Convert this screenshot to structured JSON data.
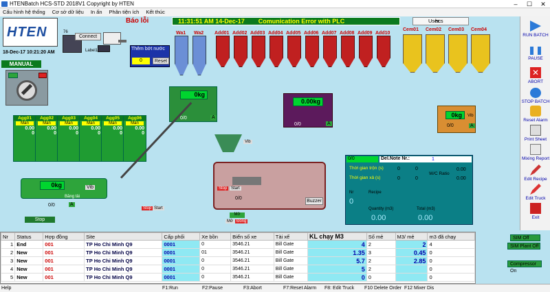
{
  "window": {
    "title": "HTENBatch HCS-STD 2018V1  Copyright by HTEN"
  },
  "menu": [
    "Cấu hình hệ thống",
    "Cơ sở dữ liệu",
    "In ấn",
    "Phân tiện ích",
    "Kết thúc"
  ],
  "header": {
    "alarm_title": "Báo lỗi",
    "time": "11:31:51 AM 14-Dec-17",
    "error": "Comunication Error with PLC",
    "user_label": "User:",
    "user": "hcs"
  },
  "logo": {
    "text": "HTEN",
    "datetime": "18-Dec-17  10:21:20 AM"
  },
  "mode": {
    "label": "MANUAL"
  },
  "network": {
    "connect": "Connect",
    "num": "76",
    "label": "Label1"
  },
  "water_add": {
    "title": "Thêm bớt nước",
    "value": "0",
    "reset": "Reset"
  },
  "water": [
    "Wa1",
    "Wa2"
  ],
  "additives": [
    "Add01",
    "Add02",
    "Add03",
    "Add04",
    "Add05",
    "Add06",
    "Add07",
    "Add08",
    "Add09",
    "Add10"
  ],
  "cements": [
    "Cem01",
    "Cem02",
    "Cem03",
    "Cem04"
  ],
  "aggregates": [
    {
      "name": "Agg01",
      "mode": "Man",
      "v1": "0.00",
      "v2": "0"
    },
    {
      "name": "Agg02",
      "mode": "Man",
      "v1": "0.00",
      "v2": "0"
    },
    {
      "name": "Agg03",
      "mode": "Man",
      "v1": "0.00",
      "v2": "0"
    },
    {
      "name": "Agg04",
      "mode": "Man",
      "v1": "0.00",
      "v2": "0"
    },
    {
      "name": "Agg05",
      "mode": "Man",
      "v1": "0.00",
      "v2": "0"
    },
    {
      "name": "Agg06",
      "mode": "Man",
      "v1": "0.00",
      "v2": "0"
    }
  ],
  "scales": {
    "water": {
      "value": "0kg",
      "ratio": "0/0",
      "flag": "A"
    },
    "additive": {
      "value": "0.00kg",
      "ratio": "0/0",
      "flag": "A"
    },
    "cement": {
      "value": "0kg",
      "ratio": "0/0",
      "flag": "A",
      "vib": "Vib"
    },
    "agg": {
      "value": "0kg",
      "ratio": "0/0",
      "flag": "A",
      "vib": "Vib",
      "belt": "Băng tải"
    }
  },
  "mixer": {
    "vib": "Vib",
    "ratio": "0/0",
    "buzzer": "Buzzer",
    "stop": "Stop",
    "start": "Start",
    "label": "Mở",
    "open": "Mở",
    "close": "Đóng"
  },
  "conveyor": {
    "stop": "Stop",
    "start": "Start",
    "stop2": "Stop"
  },
  "delnote": {
    "counter": "0/0",
    "label": "Del.Note Nr.:",
    "number": "1",
    "mix_time": "Thời gian trộn (s)",
    "mix_a": "0",
    "mix_b": "0",
    "dis_time": "Thời gian xả (s)",
    "dis_a": "0",
    "dis_b": "0",
    "wc": "W/C Ratio",
    "wc_a": "0.00",
    "wc_b": "0.00",
    "nr": "Nr",
    "nr_val": "0",
    "recipe": "Recipe",
    "qty": "Quantity (m3)",
    "total": "Total (m3)",
    "qty_val": "0.00",
    "total_val": "0.00"
  },
  "grid": {
    "headers": [
      "Nr",
      "Status",
      "Hợp đồng",
      "Site",
      "Cấp phối",
      "Xe bồn",
      "Biển số xe",
      "Tài xế",
      "KL chạy M3",
      "Số mẻ",
      "M3/ mẻ",
      "m3 đã chạy"
    ],
    "rows": [
      {
        "nr": "1",
        "status": "End",
        "contract": "001",
        "site": "TP Ho Chi Minh Q9",
        "mix": "0001",
        "truck": "0",
        "plate": "3546.21",
        "driver": "Bill Gate",
        "kl": "4",
        "batches": "2",
        "per": "2",
        "done": "4"
      },
      {
        "nr": "2",
        "status": "New",
        "contract": "001",
        "site": "TP Ho Chi Minh Q9",
        "mix": "0001",
        "truck": "01",
        "plate": "3546.21",
        "driver": "Bill Gate",
        "kl": "1.35",
        "batches": "3",
        "per": "0.45",
        "done": "0"
      },
      {
        "nr": "3",
        "status": "New",
        "contract": "001",
        "site": "TP Ho Chi Minh Q9",
        "mix": "0001",
        "truck": "0",
        "plate": "3546.21",
        "driver": "Bill Gate",
        "kl": "5.7",
        "batches": "2",
        "per": "2.85",
        "done": "0"
      },
      {
        "nr": "4",
        "status": "New",
        "contract": "001",
        "site": "TP Ho Chi Minh Q9",
        "mix": "0001",
        "truck": "0",
        "plate": "3546.21",
        "driver": "Bill Gate",
        "kl": "5",
        "batches": "2",
        "per": "",
        "done": "0"
      },
      {
        "nr": "5",
        "status": "New",
        "contract": "001",
        "site": "TP Ho Chi Minh Q9",
        "mix": "0001",
        "truck": "0",
        "plate": "3546.21",
        "driver": "Bill Gate",
        "kl": "0",
        "batches": "0",
        "per": "",
        "done": "0"
      }
    ]
  },
  "right_buttons": [
    "RUN BATCH",
    "PAUSE",
    "ABORT",
    "STOP BATCH",
    "Reset Alarm",
    "Print Sheet",
    "Mixing Report",
    "Edit Recipe",
    "Edit Truck",
    "Exit"
  ],
  "side_status": {
    "sim_off": "SIM Off",
    "sim_plant": "SIM Plant Off",
    "compressor": "Compressor On"
  },
  "status_bar": [
    "Help",
    "F1:Run",
    "F2:Pause",
    "F3:Abort",
    "F7:Reset Alarm",
    "F8: Edit Truck",
    "F10 Delete Order",
    "F12 Mixer Dis"
  ],
  "colors": {
    "accent_green": "#0b7a1e",
    "lcd": "#00d52f",
    "teal": "#0b7f86",
    "alarm_red": "#c00"
  }
}
